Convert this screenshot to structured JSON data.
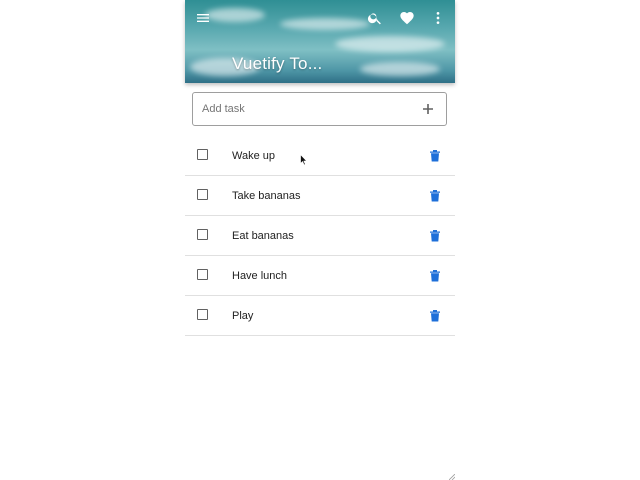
{
  "header": {
    "title": "Vuetify To...",
    "menu_icon": "menu-icon",
    "search_icon": "search-icon",
    "favorite_icon": "heart-icon",
    "more_icon": "more-vert-icon"
  },
  "add_task": {
    "placeholder": "Add task",
    "value": "",
    "add_icon": "plus-icon"
  },
  "tasks": [
    {
      "label": "Wake up",
      "done": false
    },
    {
      "label": "Take bananas",
      "done": false
    },
    {
      "label": "Eat bananas",
      "done": false
    },
    {
      "label": "Have lunch",
      "done": false
    },
    {
      "label": "Play",
      "done": false
    }
  ],
  "colors": {
    "delete_icon": "#1e6fd9",
    "checkbox_border": "#616161",
    "divider": "#e0e0e0"
  }
}
